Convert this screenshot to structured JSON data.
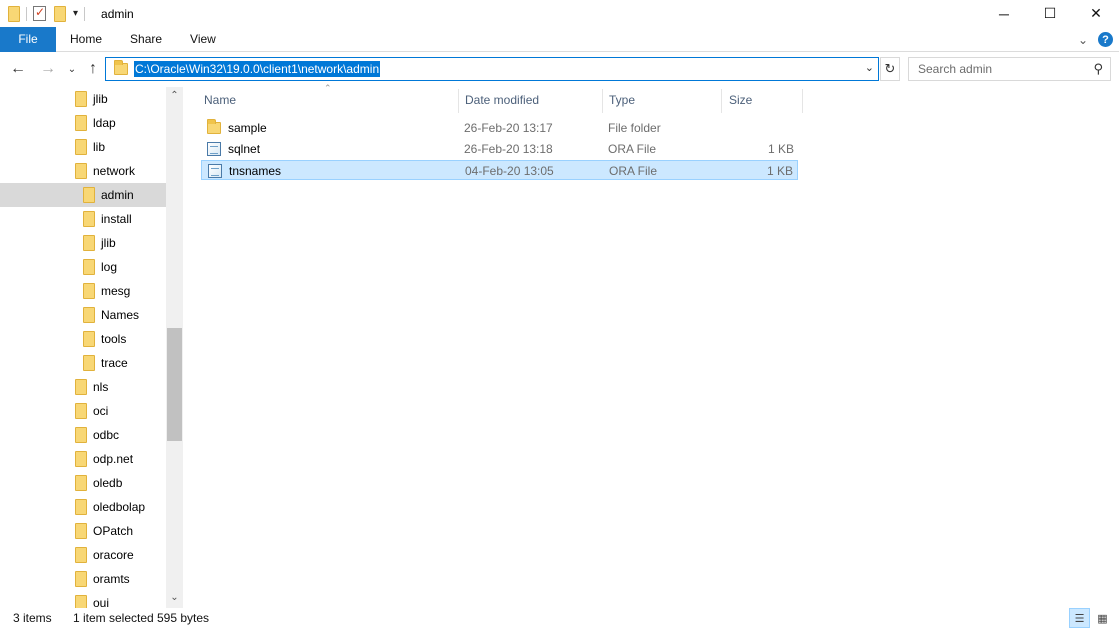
{
  "window": {
    "title": "admin",
    "controls": [
      "minimize",
      "maximize",
      "close"
    ]
  },
  "ribbon": {
    "tabs": [
      "File",
      "Home",
      "Share",
      "View"
    ]
  },
  "address_bar": {
    "path": "C:\\Oracle\\Win32\\19.0.0\\client1\\network\\admin"
  },
  "search": {
    "placeholder": "Search admin"
  },
  "nav_tree": [
    {
      "label": "jlib",
      "level": 1
    },
    {
      "label": "ldap",
      "level": 1
    },
    {
      "label": "lib",
      "level": 1
    },
    {
      "label": "network",
      "level": 1
    },
    {
      "label": "admin",
      "level": 2,
      "selected": true
    },
    {
      "label": "install",
      "level": 2
    },
    {
      "label": "jlib",
      "level": 2
    },
    {
      "label": "log",
      "level": 2
    },
    {
      "label": "mesg",
      "level": 2
    },
    {
      "label": "Names",
      "level": 2
    },
    {
      "label": "tools",
      "level": 2
    },
    {
      "label": "trace",
      "level": 2
    },
    {
      "label": "nls",
      "level": 1
    },
    {
      "label": "oci",
      "level": 1
    },
    {
      "label": "odbc",
      "level": 1
    },
    {
      "label": "odp.net",
      "level": 1
    },
    {
      "label": "oledb",
      "level": 1
    },
    {
      "label": "oledbolap",
      "level": 1
    },
    {
      "label": "OPatch",
      "level": 1
    },
    {
      "label": "oracore",
      "level": 1
    },
    {
      "label": "oramts",
      "level": 1
    },
    {
      "label": "oui",
      "level": 1
    }
  ],
  "columns": {
    "name": "Name",
    "date_modified": "Date modified",
    "type": "Type",
    "size": "Size"
  },
  "files": [
    {
      "name": "sample",
      "date_modified": "26-Feb-20 13:17",
      "type": "File folder",
      "size": "",
      "icon": "folder-icon",
      "selected": false
    },
    {
      "name": "sqlnet",
      "date_modified": "26-Feb-20 13:18",
      "type": "ORA File",
      "size": "1 KB",
      "icon": "file-icon",
      "selected": false
    },
    {
      "name": "tnsnames",
      "date_modified": "04-Feb-20 13:05",
      "type": "ORA File",
      "size": "1 KB",
      "icon": "file-icon",
      "selected": true
    }
  ],
  "status": {
    "item_count": "3 items",
    "selection": "1 item selected",
    "selection_size": "595 bytes"
  }
}
